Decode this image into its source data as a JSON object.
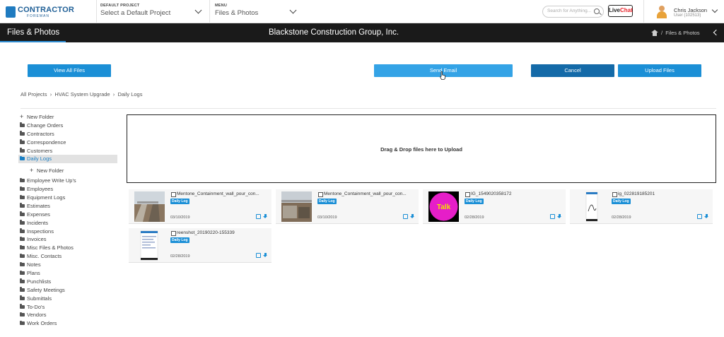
{
  "topbar": {
    "logo_main": "CONTRACTOR",
    "logo_sub": "FOREMAN",
    "project_label": "DEFAULT PROJECT",
    "project_value": "Select a Default Project",
    "menu_label": "MENU",
    "menu_value": "Files & Photos",
    "search_placeholder": "Search for Anything...",
    "livechat_live": "Live",
    "livechat_chat": "Chat",
    "user_name": "Chris Jackson",
    "user_sub": "User (102513)"
  },
  "header": {
    "title": "Files & Photos",
    "company": "Blackstone Construction Group, Inc.",
    "breadcrumb_current": "Files & Photos",
    "breadcrumb_sep": "/"
  },
  "actions": {
    "view_all": "View All Files",
    "send_email": "Send Email",
    "cancel": "Cancel",
    "upload": "Upload Files"
  },
  "breadcrumb": {
    "items": [
      "All Projects",
      "HVAC System Upgrade",
      "Daily Logs"
    ],
    "sep": "›"
  },
  "sidebar": {
    "new_folder": "New Folder",
    "folders": [
      "Change Orders",
      "Contractors",
      "Correspondence",
      "Customers",
      "Daily Logs",
      "Employee Write Up's",
      "Employees",
      "Equipment Logs",
      "Estimates",
      "Expenses",
      "Incidents",
      "Inspections",
      "Invoices",
      "Misc Files & Photos",
      "Misc. Contacts",
      "Notes",
      "Plans",
      "Punchlists",
      "Safety Meetings",
      "Submittals",
      "To-Do's",
      "Vendors",
      "Work Orders"
    ],
    "active_folder": "Daily Logs"
  },
  "dropzone": {
    "label": "Drag & Drop files here to Upload"
  },
  "files": [
    {
      "name": "Mentone_Containment_wall_pour_con...",
      "tag": "Daily Log",
      "date": "03/10/2019",
      "thumb": "construction-photo"
    },
    {
      "name": "Mentone_Containment_wall_pour_con...",
      "tag": "Daily Log",
      "date": "03/10/2019",
      "thumb": "construction-photo"
    },
    {
      "name": "IG_1549020358172",
      "tag": "Daily Log",
      "date": "02/28/2019",
      "thumb": "talk-image",
      "thumb_text": "Talk"
    },
    {
      "name": "ig_022819185201",
      "tag": "Daily Log",
      "date": "02/28/2019",
      "thumb": "phone-screenshot"
    },
    {
      "name": "reenshot_20190220-155339",
      "tag": "Daily Log",
      "date": "02/28/2019",
      "thumb": "phone-screenshot"
    }
  ],
  "colors": {
    "accent": "#1b8fd6",
    "header": "#1a1a1a",
    "active_folder": "#1b7fc4"
  }
}
